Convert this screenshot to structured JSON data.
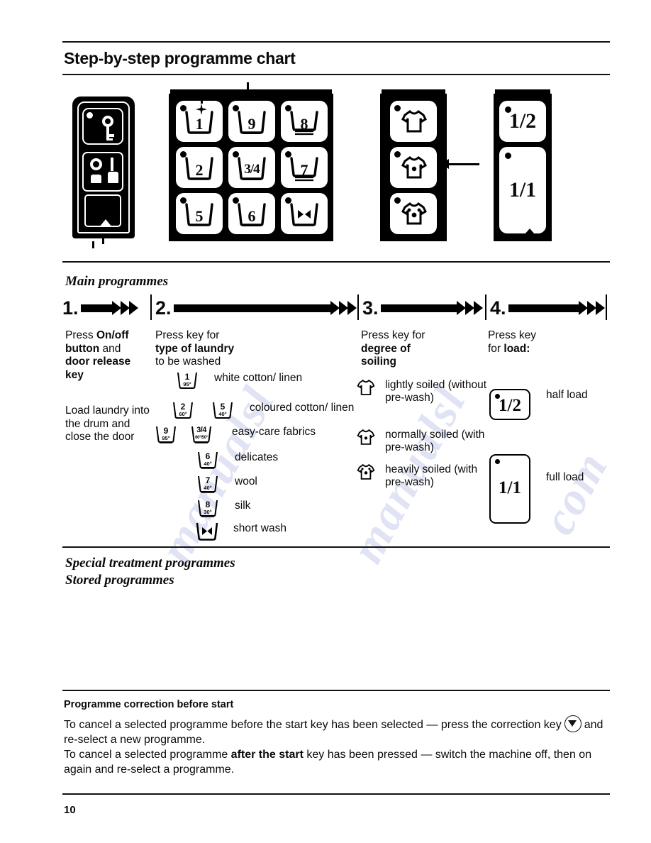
{
  "page": {
    "title": "Step-by-step programme chart",
    "number": "10"
  },
  "sections": {
    "main_programmes": "Main programmes",
    "special_treatment": "Special treatment programmes",
    "stored_programmes": "Stored programmes"
  },
  "steps": [
    {
      "num": "1."
    },
    {
      "num": "2."
    },
    {
      "num": "3."
    },
    {
      "num": "4."
    }
  ],
  "columns": {
    "step1": {
      "lead_parts": [
        "Press ",
        "On/off",
        " ",
        "button",
        " and ",
        "door release",
        " ",
        "key"
      ],
      "lead_line1_a": "Press ",
      "lead_line1_b": "On/off",
      "lead_line2_b": "button",
      "lead_line2_a": " and",
      "lead_line3_b": "door release",
      "lead_line4_b": "key",
      "second": "Load laundry into the drum and close the door"
    },
    "step2": {
      "lead_a": "Press key for",
      "lead_b": "type of laundry",
      "lead_c": "to be washed",
      "items": [
        {
          "symbols": [
            {
              "num": "1",
              "temp": "95°"
            }
          ],
          "label": "white cotton/ linen"
        },
        {
          "symbols": [
            {
              "num": "2",
              "temp": "60°"
            },
            {
              "num": "5",
              "temp": "40°"
            }
          ],
          "label": "coloured cotton/ linen"
        },
        {
          "symbols": [
            {
              "num": "9",
              "temp": "95°"
            },
            {
              "num": "3/4",
              "temp": "60°/50°"
            }
          ],
          "label": "easy-care fabrics"
        },
        {
          "symbols": [
            {
              "num": "6",
              "temp": "40°"
            }
          ],
          "label": "delicates"
        },
        {
          "symbols": [
            {
              "num": "7",
              "temp": "40°"
            }
          ],
          "label": "wool"
        },
        {
          "symbols": [
            {
              "num": "8",
              "temp": "30°"
            }
          ],
          "label": "silk"
        },
        {
          "symbols": [
            {
              "num": "short-wash-icon",
              "temp": ""
            }
          ],
          "label": "short wash"
        }
      ]
    },
    "step3": {
      "lead_a": "Press key for",
      "lead_b": "degree of",
      "lead_c": "soiling",
      "items": [
        {
          "icon": "shirt-0-dots-icon",
          "label": "lightly soiled (without pre-wash)"
        },
        {
          "icon": "shirt-1-dot-icon",
          "label": "normally soiled (with pre-wash)"
        },
        {
          "icon": "shirt-2-dots-icon",
          "label": "heavily soiled (with pre-wash)"
        }
      ]
    },
    "step4": {
      "lead_a": "Press key",
      "lead_b_pre": "for ",
      "lead_b": "load:",
      "items": [
        {
          "frac": "1/2",
          "label": "half load"
        },
        {
          "frac": "1/1",
          "label": "full load"
        }
      ]
    }
  },
  "control_panel": {
    "door_release_key_icon": "key-icon",
    "onoff_icon": "power-switch-icon",
    "door_button_icon": "door-release-icon",
    "laundry_keys": [
      {
        "num": "1",
        "icon": "wash-tub-icon"
      },
      {
        "num": "9",
        "icon": "wash-tub-icon"
      },
      {
        "num": "8",
        "icon": "wash-tub-icon"
      },
      {
        "num": "2",
        "icon": "wash-tub-icon"
      },
      {
        "num": "3/4",
        "icon": "wash-tub-icon"
      },
      {
        "num": "7",
        "icon": "wash-tub-icon"
      },
      {
        "num": "5",
        "icon": "wash-tub-icon"
      },
      {
        "num": "6",
        "icon": "wash-tub-icon"
      },
      {
        "num": "",
        "icon": "short-wash-tub-icon"
      }
    ],
    "soiling_keys": [
      {
        "icon": "shirt-0-dots-icon"
      },
      {
        "icon": "shirt-1-dot-icon"
      },
      {
        "icon": "shirt-2-dots-icon"
      }
    ],
    "load_keys": [
      {
        "frac": "1/2"
      },
      {
        "frac": "1/1"
      }
    ]
  },
  "correction": {
    "heading": "Programme correction before start",
    "p1_a": "To cancel a selected programme before the start key has been selected — press the correction key",
    "p1_b": "and re-select a new programme.",
    "p2_a": "To cancel a selected programme ",
    "p2_b": "after the start",
    "p2_c": " key has been pressed — switch the machine off, then on again and re-select a programme."
  },
  "watermark": {
    "line1": "manualsl",
    "line2": "manualsl",
    "line3": "com"
  },
  "colors": {
    "ink": "#0a0a0a",
    "paper": "#ffffff",
    "watermark": "#9aa6dd"
  }
}
